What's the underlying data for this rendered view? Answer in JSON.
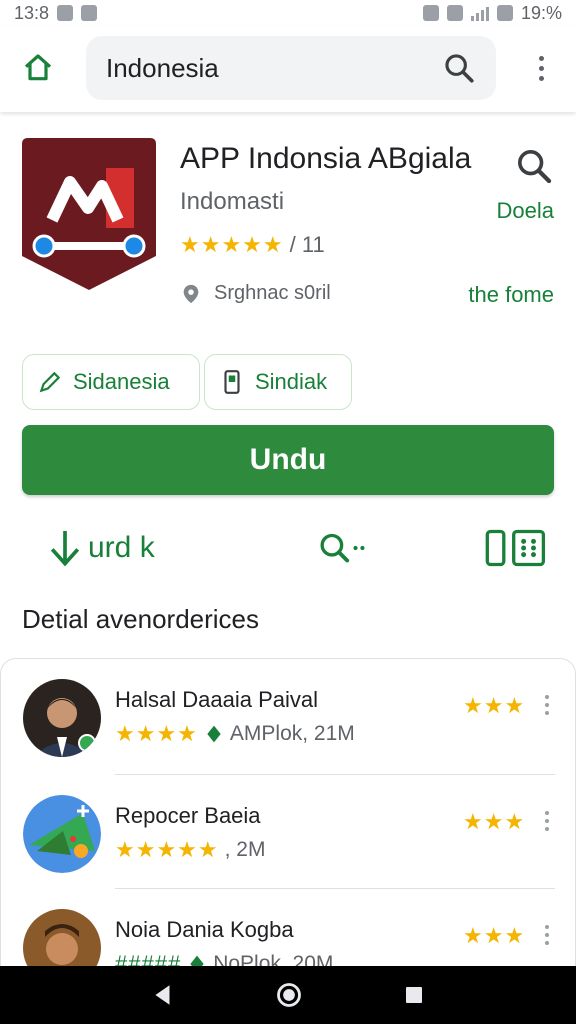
{
  "status_bar": {
    "time": "13:8",
    "battery": "19:%"
  },
  "header": {
    "search_query": "Indonesia"
  },
  "app": {
    "title": "APP Indonsia ABgiala",
    "developer": "Indomasti",
    "rating_stars": "★★★★★",
    "rating_count": "/ 11",
    "location": "Srghnac s0ril",
    "link_1": "Doela",
    "link_2": "the fome",
    "colors": {
      "accent": "#2e8b3e",
      "icon_bg": "#6b1a1f",
      "star": "#f4b400"
    }
  },
  "chips": [
    {
      "label": "Sidanesia",
      "icon": "pencil-icon"
    },
    {
      "label": "Sindiak",
      "icon": "phone-icon"
    }
  ],
  "install_label": "Undu",
  "actions": [
    {
      "label": "urd k",
      "icon": "download-icon"
    },
    {
      "label": "",
      "icon": "search-icon"
    },
    {
      "label": "",
      "icon": "book-icon"
    }
  ],
  "section_title": "Detial avenorderices",
  "reviews": [
    {
      "name": "Halsal Daaaia Paival",
      "stars": "★★★★",
      "meta": "AMPlok, 21M",
      "right_stars": "★★★"
    },
    {
      "name": "Repocer Baeia",
      "stars": "★★★★★",
      "meta": ", 2M",
      "right_stars": "★★★"
    },
    {
      "name": "Noia Dania Kogba",
      "stars": "#####",
      "meta": "NoPlok, 20M",
      "right_stars": "★★★"
    }
  ]
}
